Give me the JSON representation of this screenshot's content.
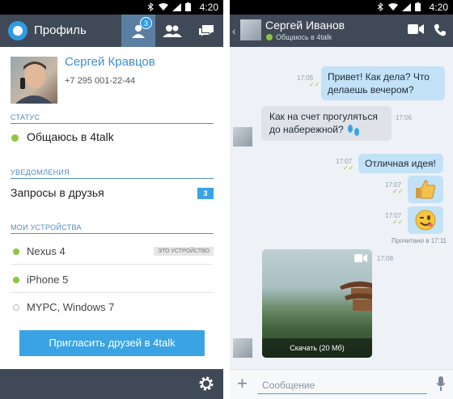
{
  "statusbar": {
    "time": "4:20"
  },
  "left": {
    "header": {
      "title": "Профиль",
      "badge": "3"
    },
    "profile": {
      "name": "Сергей Кравцов",
      "phone": "+7 295 001-22-44"
    },
    "status": {
      "section": "СТАТУС",
      "value": "Общаюсь в 4talk"
    },
    "notifications": {
      "section": "УВЕДОМЛЕНИЯ",
      "label": "Запросы в друзья",
      "count": "3"
    },
    "devices": {
      "section": "МОИ УСТРОЙСТВА",
      "tag": "ЭТО УСТРОЙСТВО",
      "items": [
        {
          "label": "Nexus 4",
          "online": true
        },
        {
          "label": "iPhone 5",
          "online": true
        },
        {
          "label": "MYPC, Windows 7",
          "online": false
        }
      ]
    },
    "invite_label": "Пригласить друзей в 4talk"
  },
  "right": {
    "header": {
      "name": "Сергей Иванов",
      "status": "Общаюсь в 4talk"
    },
    "messages": [
      {
        "text": "Привет! Как дела? Что делаешь вечером?",
        "time": "17:05",
        "dir": "out"
      },
      {
        "text": "Как на счет прогуляться до набережной?",
        "time": "17:06",
        "dir": "in"
      },
      {
        "text": "Отличная идея!",
        "time": "17:07",
        "dir": "out"
      },
      {
        "text": "",
        "time": "17:07",
        "dir": "out",
        "emoji": "thumbs-up"
      },
      {
        "text": "",
        "time": "17:07",
        "dir": "out",
        "emoji": "wink"
      }
    ],
    "read_note": "Прочитано в 17:11",
    "photo": {
      "time": "17:08",
      "caption": "Скачать (20 Мб)"
    },
    "composer": {
      "placeholder": "Сообщение"
    }
  },
  "colors": {
    "accent": "#3aa3e3",
    "header": "#3f4957",
    "online": "#8cc63f"
  }
}
